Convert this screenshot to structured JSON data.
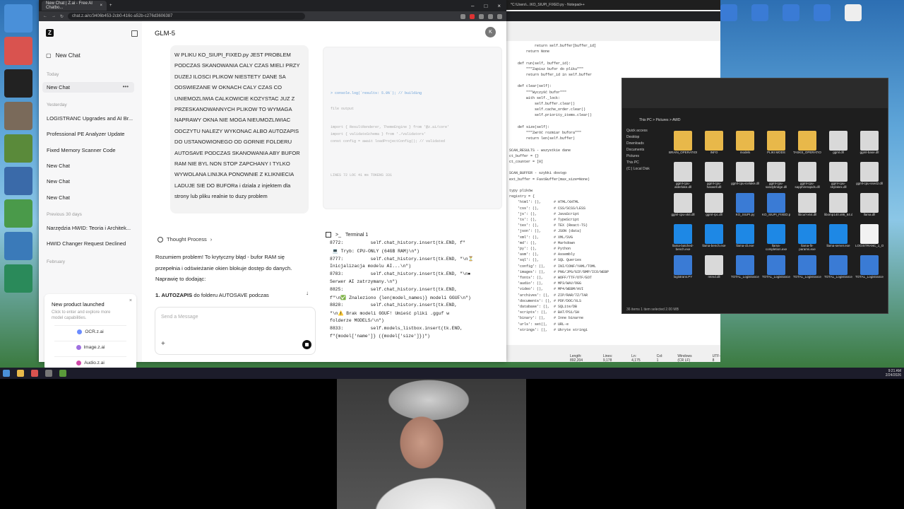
{
  "browser": {
    "tab_title": "New Chat | Z.ai - Free AI Chatbo...",
    "url": "chat.z.ai/c/3406b453-2cb0-416c-a52b-c276d3606387"
  },
  "sidebar": {
    "logo": "Z",
    "new_chat": "New Chat",
    "today_label": "Today",
    "today_items": [
      "New Chat"
    ],
    "yesterday_label": "Yesterday",
    "yesterday_items": [
      "LOGISTRANC Upgrades and AI Br...",
      "Professional PE Analyzer Update",
      "Fixed Memory Scanner Code",
      "New Chat",
      "New Chat",
      "New Chat"
    ],
    "prev30_label": "Previous 30 days",
    "prev30_items": [
      "Narzędzia HWID: Teoria i Architek...",
      "HWID Changer Request Declined"
    ],
    "february_label": "February"
  },
  "promo": {
    "title": "New product launched",
    "subtitle": "Click to enter and explore more model capabilities.",
    "items": [
      {
        "label": "OCR.z.ai",
        "color": "#6b8cff"
      },
      {
        "label": "Image.z.ai",
        "color": "#a070e0"
      },
      {
        "label": "Audio.z.ai",
        "color": "#d048a8"
      }
    ]
  },
  "main": {
    "model": "GLM-5",
    "avatar": "K",
    "user_message": "W PLIKU KO_SIUPI_FIXED.py JEST PROBLEM PODCZAS SKANOWANIA CALY CZAS MIELI PRZY DUZEJ ILOSCI PLIKOW NIESTETY DANE SA ODSWIEZANE W OKNACH CALY CZAS CO UNIEMOZLIWIA CALKOWICIE KOZYSTAC JUZ Z PRZESKANOWANNYCH PLIKOW TO WYMAGA NAPRAWY OKNA NIE MOGA NIEUMOZLIWIAC ODCZYTU NALEZY WYKONAC ALBO AUTOZAPIS DO USTANOWIONEGO OD GORNIE FOLDERU AUTOSAVE PODCZAS SKANOWANIA ABY BUFOR RAM NIE BYL NON STOP ZAPCHANY I TYLKO WYWOLANA LINIJKA PONOWNIE Z KLIKNIECIA LADUJE SIE DO BUFORa i dziala z injektem dla strony lub pliku realnie to duzy problem",
    "thought_process": "Thought Process",
    "answer": "Rozumiem problem! To krytyczny błąd - bufor RAM się przepełnia i odświeżanie okien blokuje dostęp do danych. Naprawię to dodając:",
    "answer_point_num": "1.",
    "answer_point_bold": "AUTOZAPIS",
    "answer_point_rest": "do folderu AUTOSAVE podczas",
    "input_placeholder": "Send a Message"
  },
  "artifact_code": [
    "> console.log(`results: 5.9%`); // building",
    "file output",
    "import { ResultRenderer, ThemeEngine } from '@z.ai/core'",
    "import { validateSchema } from './validators'",
    "const config = await loadProjectConfig(); // validated",
    "LINES 72      LOC 41 ms      TOKENS 331"
  ],
  "terminal": {
    "title": "Terminal 1",
    "lines": [
      "8772:          self.chat_history.insert(tk.END, f\"",
      " 💻 Tryb: CPU-ONLY (64GB RAM)\\n\")",
      "8777:          self.chat_history.insert(tk.END, \"\\n⏳",
      "Inicjalizacja modelu AI...\\n\")",
      "8783:          self.chat_history.insert(tk.END, \"\\n⏹",
      "Serwer AI zatrzymany.\\n\")",
      "8825:          self.chat_history.insert(tk.END,",
      "f\"\\n✅ Znaleziono {len(model_names)} modeli GGUF\\n\")",
      "8828:          self.chat_history.insert(tk.END,",
      "\"\\n⚠️ Brak modeli GGUF! Umieść pliki .gguf w",
      "folderze MODELS/\\n\")",
      "8833:          self.models_listbox.insert(tk.END,",
      "f\"{model['name']} ({model['size']})\")"
    ]
  },
  "notepad": {
    "title": "*C:\\Users\\...\\KO_SIUPI_FIXED.py - Notepad++",
    "lines": [
      "            return self.buffer[buffer_id]",
      "        return None",
      "",
      "    def run(self, buffer_id):",
      "        \"\"\"Zapisz bufor do pliku\"\"\"",
      "        return buffer_id in self.buffer",
      "",
      "    def clear(self):",
      "        \"\"\"Wyczyść bufor\"\"\"",
      "        with self._lock:",
      "            self.buffer.clear()",
      "            self.cache_order.clear()",
      "            self.priority_items.clear()",
      "",
      "    def size(self):",
      "        \"\"\"Zwróć rozmiar bufora\"\"\"",
      "        return len(self.buffer)",
      "",
      "SCAN_RESULTS - wszystkie dane",
      "ct_buffer = {}",
      "ct_counter = [0]",
      "",
      "SCAN_BUFFER - szybki dostęp",
      "ext_buffer = FastBuffer(max_size=None)",
      "",
      "typy plików",
      "registry = {",
      "    'html': (),      # HTML/XHTML",
      "    'css': (),       # CSS/SCSS/LESS",
      "    'js': (),        # JavaScript",
      "    'ts': (),        # TypeScript",
      "    'tex': (),       # TEX (React-TS)",
      "    'json': (),      # JSON (data)",
      "    'xml': (),       # XML/SVG",
      "    'md': (),        # Markdown",
      "    'py': (),        # Python",
      "    'asm': (),       # Assembly",
      "    'sql': (),       # SQL Queries",
      "    'config': (),    # INI/CONF/YAML/TOML",
      "    'images': (),    # PNG/JPG/GIF/BMP/ICO/WEBP",
      "    'fonts': (),     # WOFF/TTF/OTF/EOT",
      "    'audio': (),     # MP3/WAV/OGG",
      "    'video': (),     # MP4/WEBM/AVI",
      "    'archives': (),  # ZIP/RAR/7Z/TAR",
      "    'documents': (), # PDF/DOC/XLS",
      "    'database': (),  # SQLite/DB",
      "    'scripts': (),   # BAT/PS1/SH",
      "    'binary': (),    # Inne binarne",
      "    'urls': set(),   # URL-e",
      "    'strings': (),   # Ukryte stringi"
    ],
    "status": [
      "Length: 892,204",
      "Lines: 9,178",
      "Ln: 4,175",
      "Col: 1",
      "Windows (CR LF)",
      "UTF-8"
    ]
  },
  "explorer": {
    "path": "This PC > Pictures > AWD",
    "nav": [
      "Quick access",
      "Desktop",
      "Downloads",
      "Documents",
      "Pictures",
      "This PC",
      "(C:) Local Disk"
    ],
    "files": [
      {
        "name": "BRAIN_OPERATIONS",
        "kind": "folder"
      },
      {
        "name": "INFO",
        "kind": "folder"
      },
      {
        "name": "models",
        "kind": "folder"
      },
      {
        "name": "PLIKI MODS",
        "kind": "folder"
      },
      {
        "name": "TASKS_OPERATIONS",
        "kind": "folder"
      },
      {
        "name": "ggml.dll",
        "kind": "dll"
      },
      {
        "name": "ggml-base.dll",
        "kind": "dll"
      },
      {
        "name": "ggml-cpu-alderlake.dll",
        "kind": "dll"
      },
      {
        "name": "ggml-cpu-haswell.dll",
        "kind": "dll"
      },
      {
        "name": "ggml-cpu-icelake.dll",
        "kind": "dll"
      },
      {
        "name": "ggml-cpu-sandybridge.dll",
        "kind": "dll"
      },
      {
        "name": "ggml-cpu-sapphirerapids.dll",
        "kind": "dll"
      },
      {
        "name": "ggml-cpu-skylakex.dll",
        "kind": "dll"
      },
      {
        "name": "ggml-cpu-sse42.dll",
        "kind": "dll"
      },
      {
        "name": "ggml-cpu-x64.dll",
        "kind": "dll"
      },
      {
        "name": "ggml-rpc.dll",
        "kind": "dll"
      },
      {
        "name": "KO_SIUPI.py",
        "kind": "py"
      },
      {
        "name": "KO_SIUPI_FIXED.py",
        "kind": "py"
      },
      {
        "name": "libcurl-x64.dll",
        "kind": "dll"
      },
      {
        "name": "libomp140.x86_64.dll",
        "kind": "dll"
      },
      {
        "name": "llama.dll",
        "kind": "dll"
      },
      {
        "name": "llama-batched-bench.exe",
        "kind": "exe"
      },
      {
        "name": "llama-bench.exe",
        "kind": "exe"
      },
      {
        "name": "llama-cli.exe",
        "kind": "exe"
      },
      {
        "name": "llama-completion.exe",
        "kind": "exe"
      },
      {
        "name": "llama-fit-params.exe",
        "kind": "exe"
      },
      {
        "name": "llama-server.exe",
        "kind": "exe"
      },
      {
        "name": "LOGISTRANC_1_OG.txt",
        "kind": "txt"
      },
      {
        "name": "logistrans.PY",
        "kind": "py"
      },
      {
        "name": "mtmd.dll",
        "kind": "dll"
      },
      {
        "name": "TOTAL_Logistrance_MULTIGSM_OSADOWANIEM.py",
        "kind": "py"
      },
      {
        "name": "TOTAL_Logistrance_MULTIGSM_OSADOWANIEM_V2.py",
        "kind": "py"
      },
      {
        "name": "TOTAL_Logistrance_MULTIGSM_OSADOWANIEM_V3.py",
        "kind": "py"
      },
      {
        "name": "TOTAL_Logistrance_MULTIGSM_OSADOWANIEM_V4.py",
        "kind": "py"
      },
      {
        "name": "TOTAL_Logistrance_MULTIGSM_OSADOWANIEM_V5.py",
        "kind": "py"
      }
    ],
    "status": "36 items    1 item selected 2.00 MB"
  },
  "taskbar": {
    "time": "9:21 AM",
    "date": "2/24/2026"
  },
  "colors": {
    "folder": "#e8b84a",
    "dll": "#d9d9d9",
    "py": "#3a7bd5",
    "exe": "#1e88e5",
    "txt": "#f2f2f2"
  }
}
